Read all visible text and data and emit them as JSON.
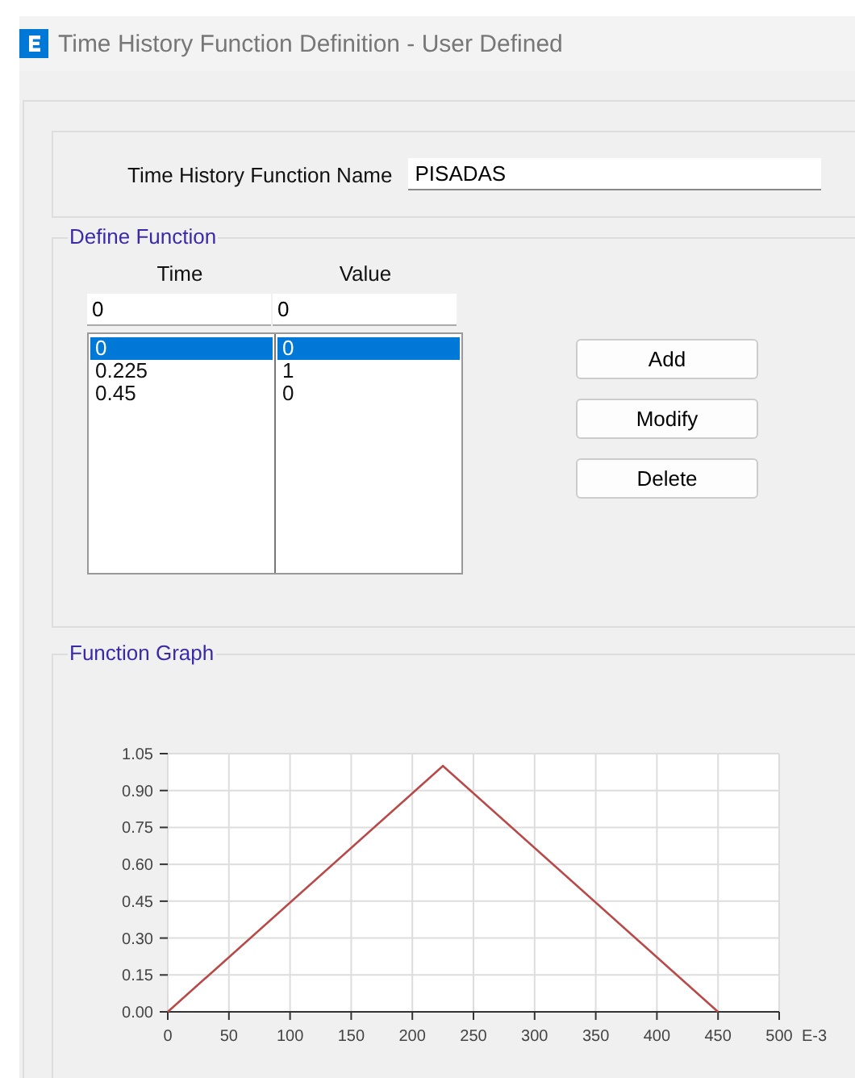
{
  "window": {
    "title": "Time History Function Definition  - User Defined"
  },
  "function_name": {
    "label": "Time History Function Name",
    "value": "PISADAS"
  },
  "define_function": {
    "title": "Define Function",
    "columns": [
      "Time",
      "Value"
    ],
    "time_input": "0",
    "value_input": "0",
    "rows": [
      {
        "time": "0",
        "value": "0",
        "selected": true
      },
      {
        "time": "0.225",
        "value": "1",
        "selected": false
      },
      {
        "time": "0.45",
        "value": "0",
        "selected": false
      }
    ],
    "buttons": [
      "Add",
      "Modify",
      "Delete"
    ]
  },
  "function_graph": {
    "title": "Function Graph",
    "chart_data": {
      "type": "line",
      "xlabel": "E-3",
      "x": [
        0,
        225,
        450
      ],
      "series": [
        {
          "color": "#b84a4a",
          "values": [
            0,
            1,
            0
          ]
        }
      ],
      "grid": true,
      "xlim": [
        0,
        500
      ],
      "ylim": [
        0,
        1.05
      ],
      "xticks": [
        0,
        50,
        100,
        150,
        200,
        250,
        300,
        350,
        400,
        450,
        500
      ],
      "yticks": [
        {
          "value": 0,
          "label": "0.00"
        },
        {
          "value": 0.15,
          "label": "0.15"
        },
        {
          "value": 0.3,
          "label": "0.30"
        },
        {
          "value": 0.45,
          "label": "0.45"
        },
        {
          "value": 0.6,
          "label": "0.60"
        },
        {
          "value": 0.75,
          "label": "0.75"
        },
        {
          "value": 0.9,
          "label": "0.90"
        },
        {
          "value": 1.05,
          "label": "1.05"
        }
      ]
    }
  }
}
